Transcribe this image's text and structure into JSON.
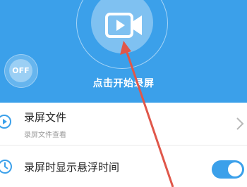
{
  "header": {
    "record_action_label": "点击开始录屏",
    "off_toggle_label": "OFF",
    "background_color": "#3ba0ea"
  },
  "settings": {
    "recordings": {
      "title": "录屏文件",
      "subtitle": "录屏文件查看",
      "icon": "play-circle-icon"
    },
    "floating_time": {
      "title": "录屏时显示悬浮时间",
      "icon": "clock-icon",
      "toggle_on": true
    }
  },
  "annotation": {
    "arrow_color": "#e0574a"
  }
}
